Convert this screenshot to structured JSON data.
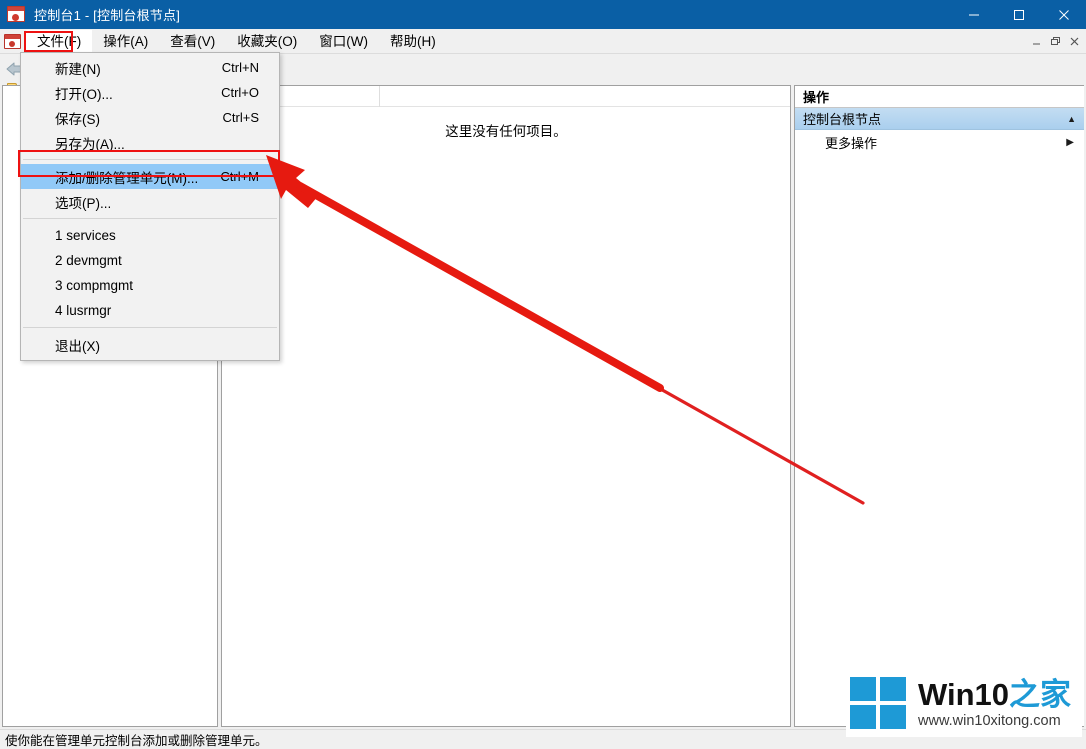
{
  "window": {
    "title": "控制台1 - [控制台根节点]",
    "icon": "mmc-console-icon",
    "minimize_label": "最小化",
    "maximize_label": "最大化",
    "close_label": "关闭"
  },
  "menubar": {
    "icon": "mmc-console-small-icon",
    "items": [
      {
        "label": "文件(F)",
        "open": true
      },
      {
        "label": "操作(A)",
        "open": false
      },
      {
        "label": "查看(V)",
        "open": false
      },
      {
        "label": "收藏夹(O)",
        "open": false
      },
      {
        "label": "窗口(W)",
        "open": false
      },
      {
        "label": "帮助(H)",
        "open": false
      }
    ],
    "mdi_minimize": "最小化",
    "mdi_restore": "还原",
    "mdi_close": "关闭"
  },
  "toolbar": {
    "back_icon": "back-arrow-icon",
    "folder_icon": "folder-icon"
  },
  "file_menu": {
    "items": [
      {
        "label": "新建(N)",
        "accel": "Ctrl+N",
        "highlight": false,
        "type": "item"
      },
      {
        "label": "打开(O)...",
        "accel": "Ctrl+O",
        "highlight": false,
        "type": "item"
      },
      {
        "label": "保存(S)",
        "accel": "Ctrl+S",
        "highlight": false,
        "type": "item"
      },
      {
        "label": "另存为(A)...",
        "accel": "",
        "highlight": false,
        "type": "item"
      },
      {
        "type": "separator"
      },
      {
        "label": "添加/删除管理单元(M)...",
        "accel": "Ctrl+M",
        "highlight": true,
        "type": "item"
      },
      {
        "label": "选项(P)...",
        "accel": "",
        "highlight": false,
        "type": "item"
      },
      {
        "type": "separator"
      },
      {
        "label": "1 services",
        "accel": "",
        "highlight": false,
        "type": "item"
      },
      {
        "label": "2 devmgmt",
        "accel": "",
        "highlight": false,
        "type": "item"
      },
      {
        "label": "3 compmgmt",
        "accel": "",
        "highlight": false,
        "type": "item"
      },
      {
        "label": "4 lusrmgr",
        "accel": "",
        "highlight": false,
        "type": "item"
      },
      {
        "type": "separator"
      },
      {
        "label": "退出(X)",
        "accel": "",
        "highlight": false,
        "type": "item"
      }
    ]
  },
  "content": {
    "empty_message": "这里没有任何项目。"
  },
  "actions": {
    "header": "操作",
    "group_label": "控制台根节点",
    "group_caret": "▲",
    "rows": [
      {
        "label": "更多操作",
        "caret": "▶"
      }
    ]
  },
  "statusbar": {
    "text": "使你能在管理单元控制台添加或删除管理单元。"
  },
  "annotations": {
    "accent_color": "#ee1111",
    "menu_box": "文件(F) 高亮框",
    "item_box": "添加/删除管理单元(M)... 高亮框",
    "arrow": "指向添加/删除管理单元的红色箭头"
  },
  "watermark": {
    "title_dark": "Win10",
    "title_blue": "之家",
    "url": "www.win10xitong.com",
    "logo_color": "#1e9ad6"
  }
}
